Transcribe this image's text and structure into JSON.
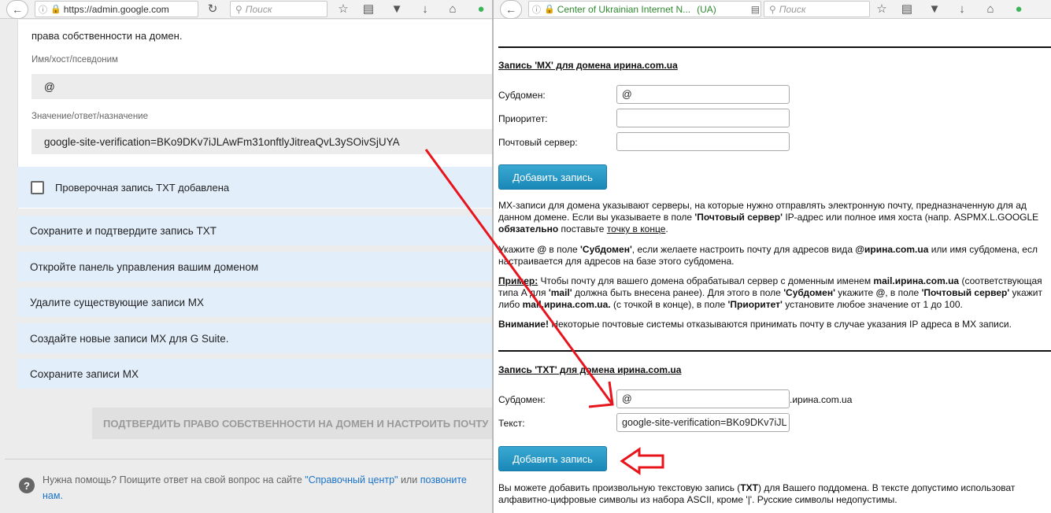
{
  "left_window": {
    "url": "https://admin.google.com",
    "url_domain": "google",
    "search_placeholder": "Поиск",
    "top_text": "права собственности на домен.",
    "host_label": "Имя/хост/псевдоним",
    "host_value": "@",
    "value_label": "Значение/ответ/назначение",
    "value_text": "google-site-verification=BKo9DKv7iJLAwFm31onftlyJitreaQvL3ySOivSjUYA",
    "checkbox_label": "Проверочная запись TXT добавлена",
    "steps": [
      "Сохраните и подтвердите запись TXT",
      "Откройте панель управления вашим доменом",
      "Удалите существующие записи MX",
      "Создайте новые записи MX для G Suite.",
      "Сохраните записи MX"
    ],
    "confirm_button": "ПОДТВЕРДИТЬ ПРАВО СОБСТВЕННОСТИ НА ДОМЕН И НАСТРОИТЬ ПОЧТУ",
    "help_prefix": "Нужна помощь? Поищите ответ на свой вопрос на сайте ",
    "help_link1": "\"Справочный центр\"",
    "help_mid": " или ",
    "help_link2": "позвоните",
    "help_line2": "нам."
  },
  "right_window": {
    "url_text": "Center of Ukrainian Internet N...",
    "url_badge": "(UA)",
    "search_placeholder": "Поиск",
    "mx_title": "Запись 'MX' для домена ирина.com.ua",
    "mx_subdomain_label": "Субдомен:",
    "mx_subdomain_value": "@",
    "mx_priority_label": "Приоритет:",
    "mx_priority_value": "",
    "mx_server_label": "Почтовый сервер:",
    "mx_server_value": "",
    "add_button": "Добавить запись",
    "p1_l1": "MX-записи для домена указывают серверы, на которые нужно отправлять электронную почту, предназначенную для ад",
    "p1_l2a": "данном домене. Если вы указываете в поле ",
    "p1_l2b": "'Почтовый сервер'",
    "p1_l2c": " IP-адрес или полное имя хоста (напр. ASPMX.L.GOOGLE",
    "p1_l3a": "обязательно",
    "p1_l3b": " поставьте ",
    "p1_l3c": "точку в конце",
    "p1_l3d": ".",
    "p2_l1a": "Укажите ",
    "p2_l1b": "@",
    "p2_l1c": " в поле ",
    "p2_l1d": "'Субдомен'",
    "p2_l1e": ", если желаете настроить почту для адресов вида ",
    "p2_l1f": "@ирина.com.ua",
    "p2_l1g": " или имя субдомена, есл",
    "p2_l2": "настраивается для адресов на базе этого субдомена.",
    "p3_l1a": "Пример:",
    "p3_l1b": " Чтобы почту для вашего домена обрабатывал сервер с доменным именем ",
    "p3_l1c": "mail.ирина.com.ua",
    "p3_l1d": " (соответствующая",
    "p3_l2a": "типа А для ",
    "p3_l2b": "'mail'",
    "p3_l2c": " должна быть внесена ранее). Для этого в поле ",
    "p3_l2d": "'Субдомен'",
    "p3_l2e": " укажите ",
    "p3_l2f": "@",
    "p3_l2g": ", в поле ",
    "p3_l2h": "'Почтовый сервер'",
    "p3_l2i": " укажит",
    "p3_l3a": "либо ",
    "p3_l3b": "mail.ирина.com.ua.",
    "p3_l3c": " (с точкой в конце), в поле ",
    "p3_l3d": "'Приоритет'",
    "p3_l3e": " установите любое значение от 1 до 100.",
    "p4a": "Внимание!",
    "p4b": " Некоторые почтовые системы отказываются принимать почту в случае указания IP адреса в MX записи.",
    "txt_title": "Запись 'TXT' для домена ирина.com.ua",
    "txt_subdomain_label": "Субдомен:",
    "txt_subdomain_value": "@",
    "txt_suffix": ".ирина.com.ua",
    "txt_text_label": "Текст:",
    "txt_text_value": "google-site-verification=BKo9DKv7iJL",
    "p5_l1a": "Вы можете добавить произвольную текстовую запись (",
    "p5_l1b": "TXT",
    "p5_l1c": ") для Вашего поддомена. В тексте допустимо использоват",
    "p5_l2": "алфавитно-цифровые символы из набора ASCII, кроме '|'. Русские символы недопустимы."
  },
  "annotations": {
    "arrow_color": "#e8141c"
  },
  "icons": [
    "back-arrow-icon",
    "info-icon",
    "lock-icon",
    "reload-icon",
    "reader-icon",
    "search-icon",
    "star-icon",
    "clipboard-icon",
    "pocket-icon",
    "download-icon",
    "home-icon",
    "extension-icon",
    "help-icon"
  ]
}
